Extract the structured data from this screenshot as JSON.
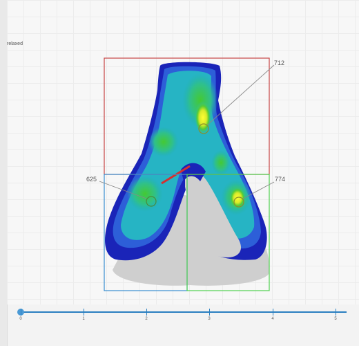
{
  "view": {
    "mode_label": "relaxed"
  },
  "callouts": [
    {
      "label": "712",
      "box_color": "#d24a4a"
    },
    {
      "label": "625",
      "box_color": "#3a8fd0"
    },
    {
      "label": "774",
      "box_color": "#4fd14f"
    }
  ],
  "timeline": {
    "ticks": [
      "0",
      "1",
      "2",
      "3",
      "4",
      "5"
    ],
    "current": 0,
    "accent": "#2a7fc0"
  }
}
